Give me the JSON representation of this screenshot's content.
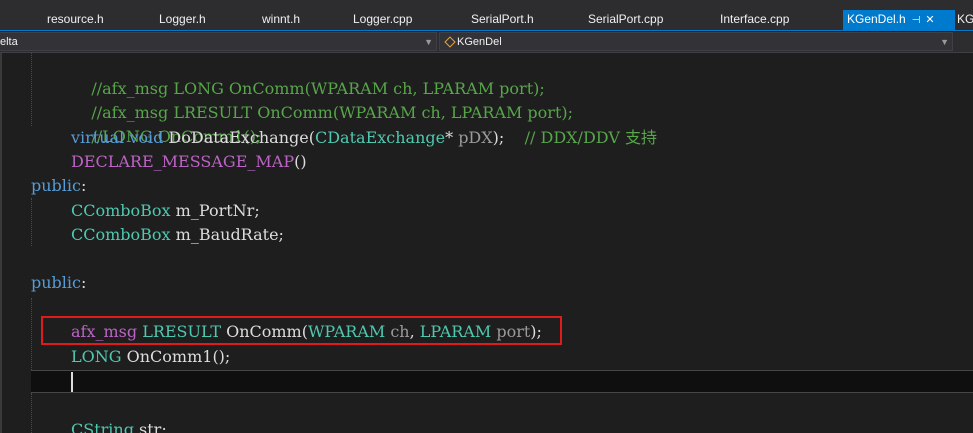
{
  "tabs": [
    {
      "label": "resource.h"
    },
    {
      "label": "Logger.h"
    },
    {
      "label": "winnt.h"
    },
    {
      "label": "Logger.cpp"
    },
    {
      "label": "SerialPort.h"
    },
    {
      "label": "SerialPort.cpp"
    },
    {
      "label": "Interface.cpp"
    },
    {
      "label": "KGenDel.h",
      "active": true,
      "pin_icon": "pin-icon",
      "close_icon": "close-icon"
    },
    {
      "label": "KG"
    }
  ],
  "navigation": {
    "project_combo": "elta",
    "class_combo": "KGenDel"
  },
  "code": {
    "l1": {
      "comment": "//afx_msg LONG OnComm(WPARAM ch, LPARAM port);"
    },
    "l2": {
      "comment": "//afx_msg LRESULT OnComm(WPARAM ch, LPARAM port);"
    },
    "l3": {
      "comment": "//LONG OnComm1();"
    },
    "l4": {
      "kw1": "virtual",
      "sp1": " ",
      "kw2": "void",
      "fn": " DoDataExchange(",
      "type": "CDataExchange",
      "star": "* ",
      "param": "pDX",
      "close": ");",
      "gap": "    ",
      "comment": "// DDX/DDV 支持"
    },
    "l5": {
      "macro": "DECLARE_MESSAGE_MAP",
      "rest": "()"
    },
    "l6": {
      "access": "public",
      "colon": ":"
    },
    "l7": {
      "type": "CComboBox",
      "rest": " m_PortNr;"
    },
    "l8": {
      "type": "CComboBox",
      "rest": " m_BaudRate;"
    },
    "l9": {
      "access": "public",
      "colon": ":"
    },
    "l10": {
      "macro": "afx_msg",
      "sp1": " ",
      "type1": "LRESULT",
      "fn": " OnComm(",
      "type2": "WPARAM",
      "sp2": " ",
      "p1": "ch",
      "comma": ", ",
      "type3": "LPARAM",
      "sp3": " ",
      "p2": "port",
      "close": ");"
    },
    "l11": {
      "type": "LONG",
      "rest": " OnComm1();"
    },
    "l12": {
      "type": "CString",
      "rest": " str;"
    }
  },
  "colors": {
    "comment": "#57a64a",
    "keyword": "#569cd6",
    "type": "#4ec9b0",
    "macro": "#bd63c5",
    "highlight_box": "#e01b1b",
    "active_tab": "#007acc"
  }
}
